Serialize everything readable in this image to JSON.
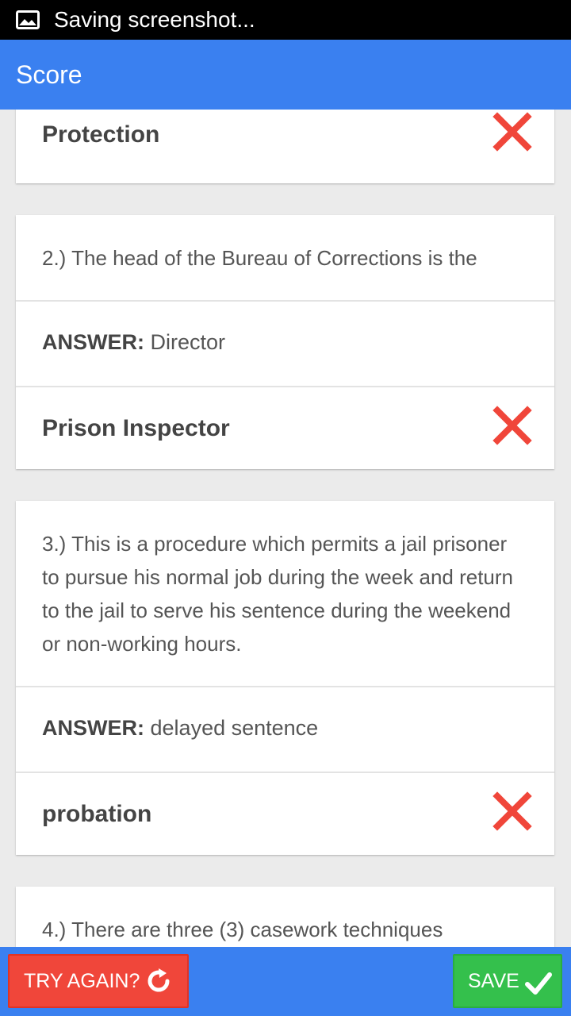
{
  "status_bar": {
    "text": "Saving screenshot...",
    "icon": "image-icon"
  },
  "app_bar": {
    "title": "Score"
  },
  "cards": [
    {
      "choice": "Protection",
      "result_icon": "cross-icon"
    },
    {
      "question": "2.) The head of the Bureau of Corrections is the",
      "answer_label": "ANSWER:",
      "answer": "Director",
      "choice": "Prison Inspector",
      "result_icon": "cross-icon"
    },
    {
      "question": "3.) This is a procedure which permits a jail prisoner to pursue his normal job during the week and return to the jail to serve his sentence during the weekend or non-working hours.",
      "answer_label": "ANSWER:",
      "answer": "delayed sentence",
      "choice": "probation",
      "result_icon": "cross-icon"
    },
    {
      "question": "4.) There are three (3) casework techniques"
    }
  ],
  "bottom_bar": {
    "try_again_label": "TRY AGAIN?",
    "try_again_icon": "refresh-icon",
    "save_label": "SAVE",
    "save_icon": "check-icon"
  },
  "colors": {
    "primary": "#3a80f0",
    "wrong": "#f0463a",
    "success": "#34c04c",
    "status_bar": "#000000",
    "background": "#ebebeb"
  }
}
